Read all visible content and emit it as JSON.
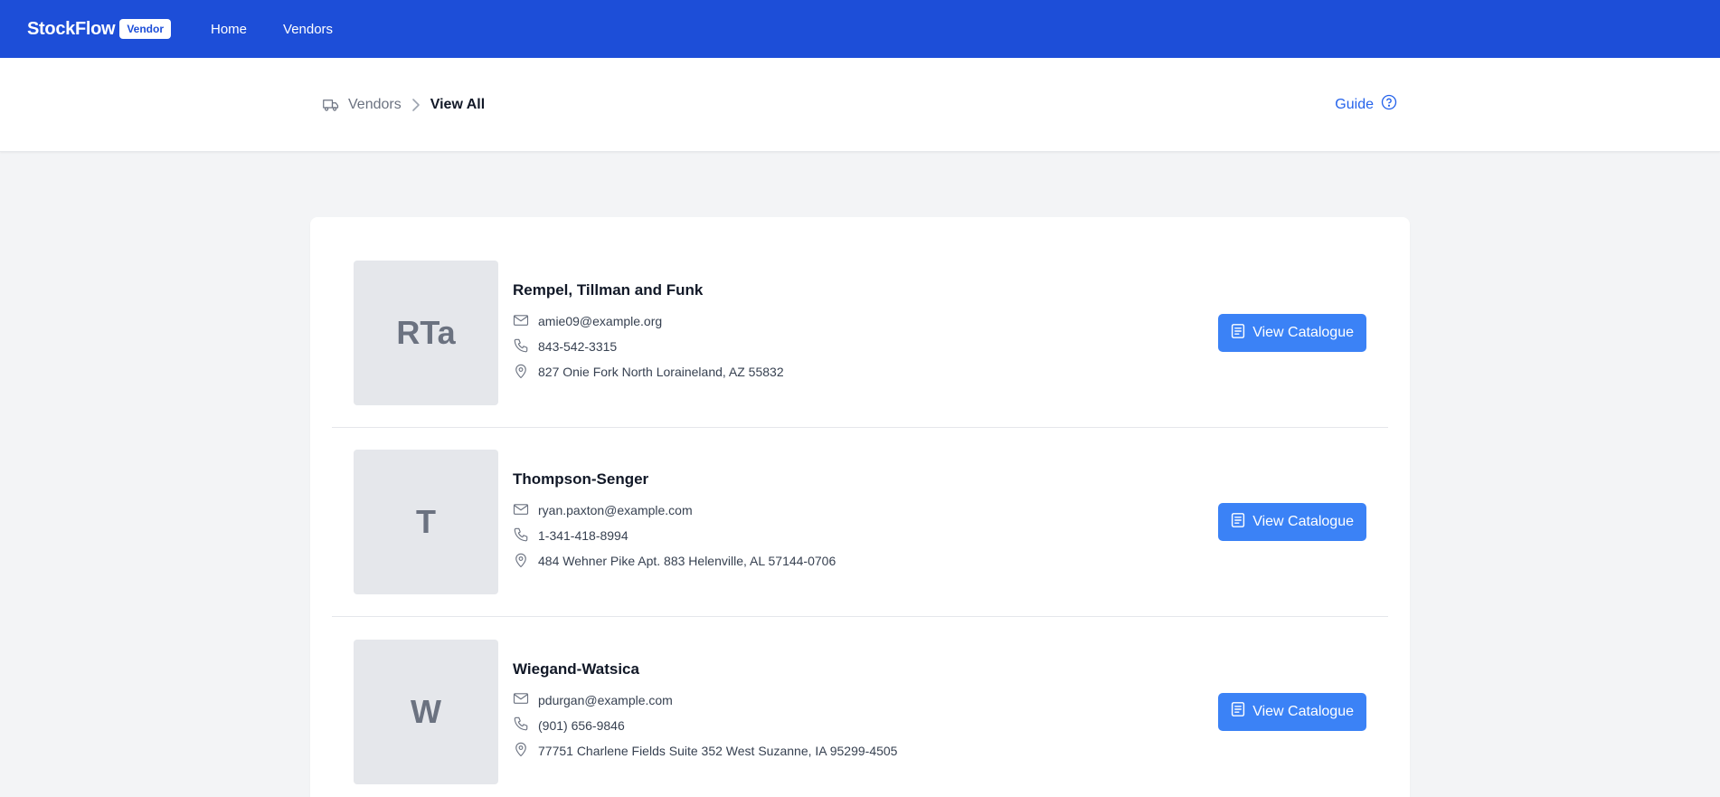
{
  "app": {
    "name": "StockFlow",
    "badge": "Vendor"
  },
  "nav": [
    {
      "label": "Home"
    },
    {
      "label": "Vendors"
    }
  ],
  "breadcrumb": {
    "parent": "Vendors",
    "current": "View All"
  },
  "guide_label": "Guide",
  "colors": {
    "brand": "#1d4ed8",
    "button": "#3b82f6",
    "link": "#2563eb"
  },
  "vendors": [
    {
      "initials": "RTa",
      "name": "Rempel, Tillman and Funk",
      "email": "amie09@example.org",
      "phone": "843-542-3315",
      "address": "827 Onie Fork North Loraineland, AZ 55832",
      "button": "View Catalogue"
    },
    {
      "initials": "T",
      "name": "Thompson-Senger",
      "email": "ryan.paxton@example.com",
      "phone": "1-341-418-8994",
      "address": "484 Wehner Pike Apt. 883 Helenville, AL 57144-0706",
      "button": "View Catalogue"
    },
    {
      "initials": "W",
      "name": "Wiegand-Watsica",
      "email": "pdurgan@example.com",
      "phone": "(901) 656-9846",
      "address": "77751 Charlene Fields Suite 352 West Suzanne, IA 95299-4505",
      "button": "View Catalogue"
    }
  ]
}
